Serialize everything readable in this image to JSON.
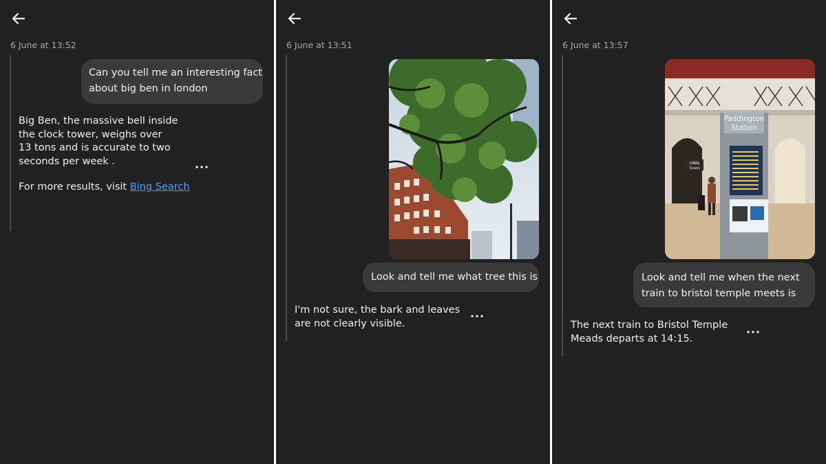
{
  "panels": [
    {
      "timestamp": "6 June at 13:52",
      "user_message": [
        "Can you tell me an interesting fact",
        "about big ben in london"
      ],
      "ai_response": [
        "Big Ben, the massive bell inside",
        "the clock tower, weighs over",
        "13 tons and is accurate to two",
        "seconds per week ."
      ],
      "ai_more_text": "For more results, visit ",
      "ai_link": "Bing Search"
    },
    {
      "timestamp": "6 June at 13:51",
      "user_message": [
        "Look and tell me what tree this is"
      ],
      "ai_response": [
        "I'm not sure, the bark and leaves",
        "are not clearly visible."
      ]
    },
    {
      "timestamp": "6 June at 13:57",
      "user_message": [
        "Look and tell me when the next",
        "train to bristol temple meets is"
      ],
      "ai_response": [
        "The next train to Bristol Temple",
        "Meads departs at 14:15."
      ],
      "photo_sign": [
        "Paddington",
        "Station"
      ],
      "photo_shop_sign": [
        "oWa",
        "Tickets"
      ]
    }
  ],
  "colors": {
    "background": "#212121",
    "bubble": "#3a3a3a",
    "text": "#f1f1f1",
    "timestamp": "#a9a9a9",
    "link": "#4aa3ff"
  },
  "icons": {
    "back": "arrow-left-icon",
    "more": "more-horizontal-icon"
  }
}
